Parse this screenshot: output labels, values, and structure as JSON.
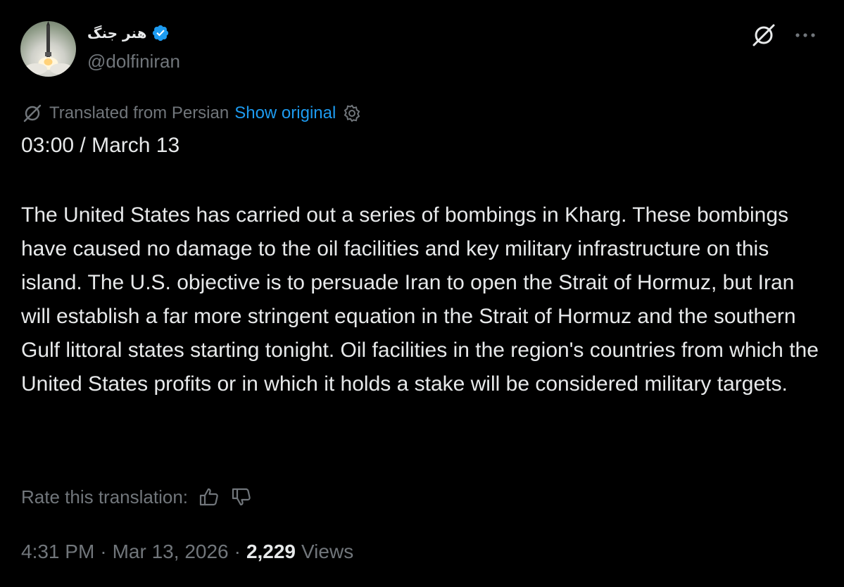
{
  "author": {
    "display_name": "هنر جنگ",
    "handle": "@dolfiniran",
    "verified": true,
    "verified_color": "#1d9bf0"
  },
  "icons": {
    "verified": "verified-badge-icon",
    "grok": "grok-icon",
    "more": "more-options-icon",
    "translate": "translate-icon",
    "settings": "gear-icon",
    "thumbs_up": "thumbs-up-icon",
    "thumbs_down": "thumbs-down-icon"
  },
  "translation": {
    "label": "Translated from Persian",
    "show_original": "Show original",
    "rate_label": "Rate this translation:"
  },
  "tweet": {
    "time_line": "03:00 / March 13",
    "body": "The United States has carried out a series of bombings in Kharg. These bombings have caused no damage to the oil facilities and key military infrastructure on this island. The U.S. objective is to persuade Iran to open the Strait of Hormuz, but Iran will establish a far more stringent equation in the Strait of Hormuz and the southern Gulf littoral states starting tonight. Oil facilities in the region's countries from which the United States profits or in which it holds a stake will be considered military targets."
  },
  "meta": {
    "time": "4:31 PM",
    "separator": "·",
    "date": "Mar 13, 2026",
    "views_count": "2,229",
    "views_label": "Views"
  },
  "colors": {
    "background": "#000000",
    "text": "#e7e9ea",
    "muted": "#71767b",
    "link": "#1d9bf0"
  }
}
